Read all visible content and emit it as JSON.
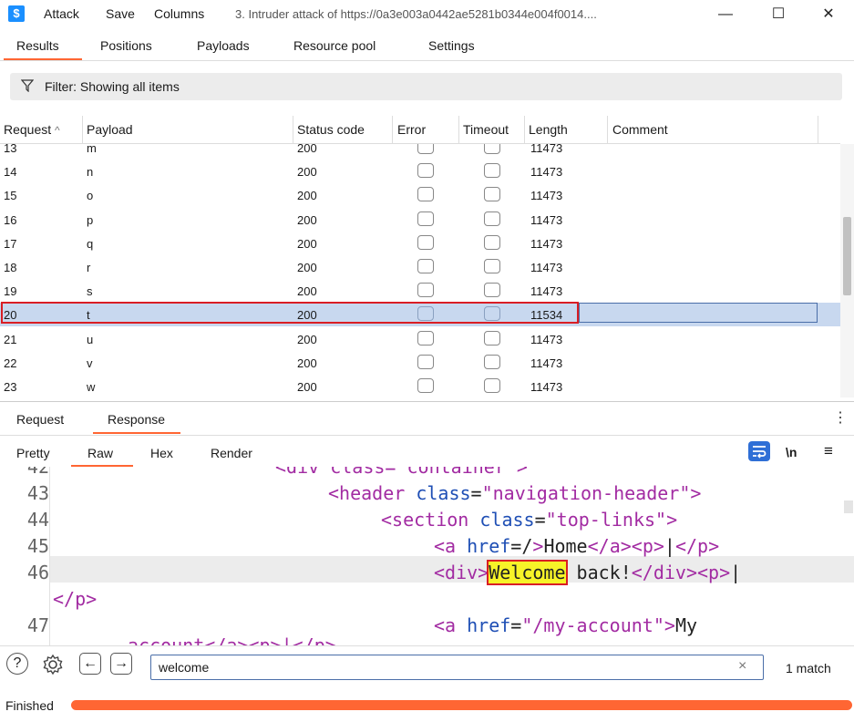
{
  "window": {
    "logo": "$",
    "menu": [
      "Attack",
      "Save",
      "Columns"
    ],
    "title": "3. Intruder attack of https://0a3e003a0442ae5281b0344e004f0014....",
    "controls": [
      "—",
      "☐",
      "✕"
    ]
  },
  "tabs": [
    "Results",
    "Positions",
    "Payloads",
    "Resource pool",
    "Settings"
  ],
  "active_tab": "Results",
  "filter": {
    "label": "Filter: Showing all items",
    "icon": "funnel-icon"
  },
  "table": {
    "columns": [
      "Request",
      "Payload",
      "Status code",
      "Error",
      "Timeout",
      "Length",
      "Comment"
    ],
    "sort_indicator": "^",
    "rows": [
      {
        "request": "13",
        "payload": "m",
        "status": "200",
        "length": "11473",
        "selected": false
      },
      {
        "request": "14",
        "payload": "n",
        "status": "200",
        "length": "11473",
        "selected": false
      },
      {
        "request": "15",
        "payload": "o",
        "status": "200",
        "length": "11473",
        "selected": false
      },
      {
        "request": "16",
        "payload": "p",
        "status": "200",
        "length": "11473",
        "selected": false
      },
      {
        "request": "17",
        "payload": "q",
        "status": "200",
        "length": "11473",
        "selected": false
      },
      {
        "request": "18",
        "payload": "r",
        "status": "200",
        "length": "11473",
        "selected": false
      },
      {
        "request": "19",
        "payload": "s",
        "status": "200",
        "length": "11473",
        "selected": false
      },
      {
        "request": "20",
        "payload": "t",
        "status": "200",
        "length": "11534",
        "selected": true
      },
      {
        "request": "21",
        "payload": "u",
        "status": "200",
        "length": "11473",
        "selected": false
      },
      {
        "request": "22",
        "payload": "v",
        "status": "200",
        "length": "11473",
        "selected": false
      },
      {
        "request": "23",
        "payload": "w",
        "status": "200",
        "length": "11473",
        "selected": false
      }
    ]
  },
  "detail_tabs": [
    "Request",
    "Response"
  ],
  "active_detail_tab": "Response",
  "kebab": "⋮",
  "view_tabs": [
    "Pretty",
    "Raw",
    "Hex",
    "Render"
  ],
  "active_view_tab": "Raw",
  "view_tools": {
    "newline": "\\n",
    "menu": "≡"
  },
  "code": {
    "partial_top": "<div class=\"container\">",
    "lines": [
      {
        "num": "43",
        "parts": [
          [
            "tag",
            "<header "
          ],
          [
            "attr",
            "class"
          ],
          [
            "txt",
            "="
          ],
          [
            "str",
            "\"navigation-header\""
          ],
          [
            "tag",
            ">"
          ]
        ]
      },
      {
        "num": "44",
        "parts": [
          [
            "tag",
            "<section "
          ],
          [
            "attr",
            "class"
          ],
          [
            "txt",
            "="
          ],
          [
            "str",
            "\"top-links\""
          ],
          [
            "tag",
            ">"
          ]
        ]
      },
      {
        "num": "45",
        "parts": [
          [
            "tag",
            "<a "
          ],
          [
            "attr",
            "href"
          ],
          [
            "txt",
            "=/"
          ],
          [
            "tag",
            ">"
          ],
          [
            "txt",
            "Home"
          ],
          [
            "tag",
            "</a><p>"
          ],
          [
            "txt",
            "|"
          ],
          [
            "tag",
            "</p>"
          ]
        ]
      },
      {
        "num": "46",
        "parts": [
          [
            "tag",
            "<div>"
          ],
          [
            "hl",
            "Welcome"
          ],
          [
            "txt",
            " back!"
          ],
          [
            "tag",
            "</div><p>"
          ],
          [
            "txt",
            "|"
          ]
        ]
      },
      {
        "num": "",
        "parts": [
          [
            "tag",
            "</p>"
          ]
        ]
      },
      {
        "num": "47",
        "parts": [
          [
            "tag",
            "<a "
          ],
          [
            "attr",
            "href"
          ],
          [
            "txt",
            "="
          ],
          [
            "str",
            "\"/my-account\""
          ],
          [
            "tag",
            ">"
          ],
          [
            "txt",
            "My"
          ]
        ]
      }
    ],
    "partial_bottom": "account</a><p>|</p>"
  },
  "search": {
    "value": "welcome",
    "clear": "×",
    "result": "1 match"
  },
  "status": {
    "label": "Finished",
    "progress_pct": 100
  }
}
